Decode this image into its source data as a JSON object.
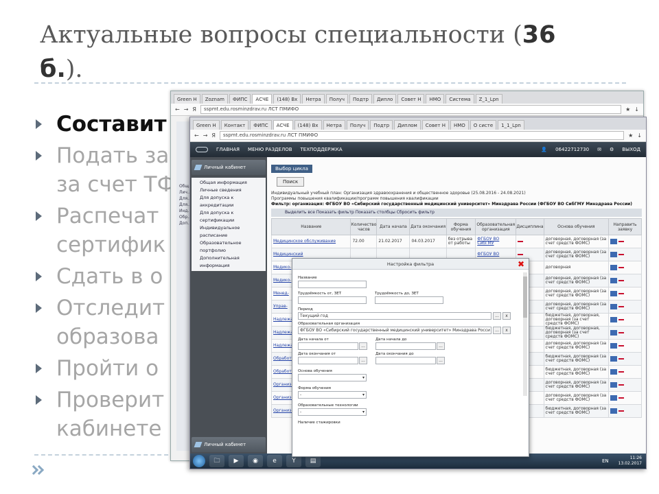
{
  "slide": {
    "title_main": "Актуальные вопросы специальности (",
    "title_bold_num": "36",
    "title_bold_b": "б.",
    "title_end": ").",
    "bullets": [
      "Составит",
      "Подать за",
      "за счет ТФ",
      "Распечат",
      "сертифик",
      "Сдать в о",
      "Отследит",
      "образова",
      "Пройти о",
      "Проверит",
      "кабинете"
    ]
  },
  "back_window": {
    "tabs": [
      "Green H",
      "Zoznam",
      "ФИПС",
      "АСЧЕ",
      "(148) Bx",
      "Нетра",
      "Получ",
      "Подтр",
      "Дипло",
      "Совет Н",
      "НМО",
      "Система",
      "Z_1_Lpn"
    ],
    "url": "sspmt.edu.rosminzdrav.ru ЛСТ ПМИФО",
    "side_items": [
      "Общ...",
      "Лич...",
      "Для...",
      "Для...",
      "Инд...",
      "Обр...",
      "Доп..."
    ]
  },
  "front_window": {
    "tabs": [
      "Green H",
      "Контакт",
      "ФИПС",
      "АСЧЕ",
      "(148) Вх",
      "Нетра",
      "Получ",
      "Подтр",
      "Диплом",
      "Совет Н",
      "НМО",
      "О систе",
      "1_1_Lpn"
    ],
    "url": "sspmt.edu.rosminzdrav.ru ЛСТ ПМИФО",
    "header": {
      "nav_home": "ГЛАВНАЯ",
      "nav_menu": "МЕНЮ РАЗДЕЛОВ",
      "nav_support": "ТЕХПОДДЕРЖКА",
      "phone": "06422712730",
      "exit": "ВЫХОД"
    },
    "sidebar": {
      "title": "Личный кабинет",
      "items": [
        "Общая информация",
        "Личные сведения",
        "Для допуска к аккредитации",
        "Для допуска к сертификации",
        "Индивидуальное расписание",
        "Образовательное портфолио",
        "Дополнительная информация"
      ],
      "bottom_title": "Личный кабинет"
    },
    "main": {
      "tab": "Выбор цикла",
      "search_button": "Поиск",
      "filter_line1": "Индивидуальный учебный план: Организация здравоохранения и общественное здоровье (25.08.2016 - 24.08.2021)",
      "filter_line2": "Программы повышения квалификации/программ повышения квалификации",
      "filter_line3": "Фильтр: организация: ФГБОУ ВО «Сибирский государственный медицинский университет» Минздрава России (ФГБОУ ВО СибГМУ Минздрава России)",
      "toolbar": "Выделить все   Показать фильтр   Показать столбцы   Сбросить фильтр",
      "columns": [
        "Название",
        "Количество часов",
        "Дата начала",
        "Дата окончания",
        "Форма обучения",
        "Образовательная организация",
        "Дисциплина",
        "Основа обучения",
        "Направить заявку"
      ],
      "rows": [
        {
          "name": "Медицинское обслуживание",
          "hours": "72.00",
          "start": "21.02.2017",
          "end": "04.03.2017",
          "form": "без отрыва от работы",
          "org": "ФГБОУ ВО СибГМУ",
          "basis": "договорная, договорная (за счет средств ФОМС)"
        },
        {
          "name": "Медицинский",
          "hours": "",
          "start": "",
          "end": "",
          "form": "",
          "org": "ФГБОУ ВО",
          "basis": "договорная, договорная (за счет средств ФОМС)"
        },
        {
          "name": "Медико-",
          "hours": "",
          "start": "",
          "end": "",
          "form": "",
          "org": "",
          "basis": "договорная"
        },
        {
          "name": "Медико-",
          "hours": "",
          "start": "",
          "end": "",
          "form": "",
          "org": "",
          "basis": "договорная, договорная (за счет средств ФОМС)"
        },
        {
          "name": "Менед-",
          "hours": "",
          "start": "",
          "end": "",
          "form": "",
          "org": "",
          "basis": "договорная, договорная (за счет средств ФОМС)"
        },
        {
          "name": "Управ-",
          "hours": "",
          "start": "",
          "end": "",
          "form": "",
          "org": "",
          "basis": "договорная, договорная (за счет средств ФОМС)"
        },
        {
          "name": "Надлежащ-",
          "hours": "",
          "start": "",
          "end": "",
          "form": "",
          "org": "",
          "basis": "бюджетная, договорная, договорная (за счет средств ФОМС)"
        },
        {
          "name": "Надлежащ-",
          "hours": "",
          "start": "",
          "end": "",
          "form": "",
          "org": "",
          "basis": "бюджетная, договорная, договорная (за счет средств ФОМС)"
        },
        {
          "name": "Надлежащ-",
          "hours": "",
          "start": "",
          "end": "",
          "form": "",
          "org": "",
          "basis": "договорная, договорная (за счет средств ФОМС)"
        },
        {
          "name": "Обработ-",
          "hours": "",
          "start": "",
          "end": "",
          "form": "",
          "org": "",
          "basis": "бюджетная, договорная (за счет средств ФОМС)"
        },
        {
          "name": "Обработ-",
          "hours": "",
          "start": "",
          "end": "",
          "form": "",
          "org": "",
          "basis": "бюджетная, договорная (за счет средств ФОМС)"
        },
        {
          "name": "Организ-",
          "hours": "",
          "start": "",
          "end": "",
          "form": "",
          "org": "",
          "basis": "договорная, договорная (за счет средств ФОМС)"
        },
        {
          "name": "Организ-",
          "hours": "",
          "start": "",
          "end": "",
          "form": "",
          "org": "",
          "basis": "договорная, договорная (за счет средств ФОМС)"
        },
        {
          "name": "Организ-",
          "hours": "",
          "start": "",
          "end": "",
          "form": "",
          "org": "",
          "basis": "бюджетная, договорная (за счет средств ФОМС)"
        }
      ]
    },
    "modal": {
      "title": "Настройка фильтра",
      "close": "✖",
      "name_label": "Название",
      "labor_from_label": "Трудоёмкость от, ЗЕТ",
      "labor_to_label": "Трудоёмкость до, ЗЕТ",
      "period_label": "Период",
      "period_value": "Текущий год",
      "org_label": "Образовательная организация",
      "org_value": "ФГБОУ ВО «Сибирский государственный медицинский университет» Минздрава Росси",
      "date_start_from": "Дата начала от",
      "date_start_to": "Дата начала до",
      "date_end_from": "Дата окончания от",
      "date_end_to": "Дата окончания до",
      "basis_label": "Основа обучения",
      "form_label": "Форма обучения",
      "form_value": "-",
      "technology_label": "Образовательные технологии",
      "technology_value": "-",
      "stage_label": "Наличие стажировки",
      "ellipsis": "...",
      "x": "x"
    },
    "taskbar": {
      "lang": "EN",
      "time": "11:26",
      "date": "13.02.2017"
    }
  }
}
